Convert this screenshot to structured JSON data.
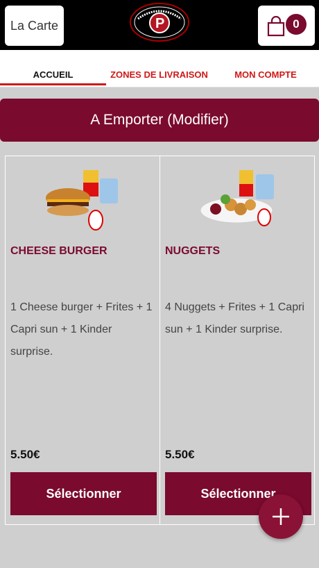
{
  "header": {
    "menu_button_label": "La Carte",
    "logo_text": "LES DELICES DE PITHIVIERS",
    "cart_count": "0"
  },
  "tabs": [
    {
      "label": "ACCUEIL"
    },
    {
      "label": "ZONES DE LIVRAISON"
    },
    {
      "label": "MON COMPTE"
    }
  ],
  "banner": {
    "label": "A Emporter (Modifier)"
  },
  "products": [
    {
      "title": "CHEESE BURGER",
      "description": "1 Cheese burger + Frites + 1 Capri sun + 1 Kinder surprise.",
      "price": "5.50€",
      "button_label": "Sélectionner"
    },
    {
      "title": "NUGGETS",
      "description": "4 Nuggets + Frites + 1 Capri sun + 1 Kinder surprise.",
      "price": "5.50€",
      "button_label": "Sélectionner"
    }
  ],
  "colors": {
    "brand": "#7a0a2e",
    "tab_active": "#d01818"
  },
  "icons": [
    "shopping-bag-icon",
    "plus-icon"
  ]
}
